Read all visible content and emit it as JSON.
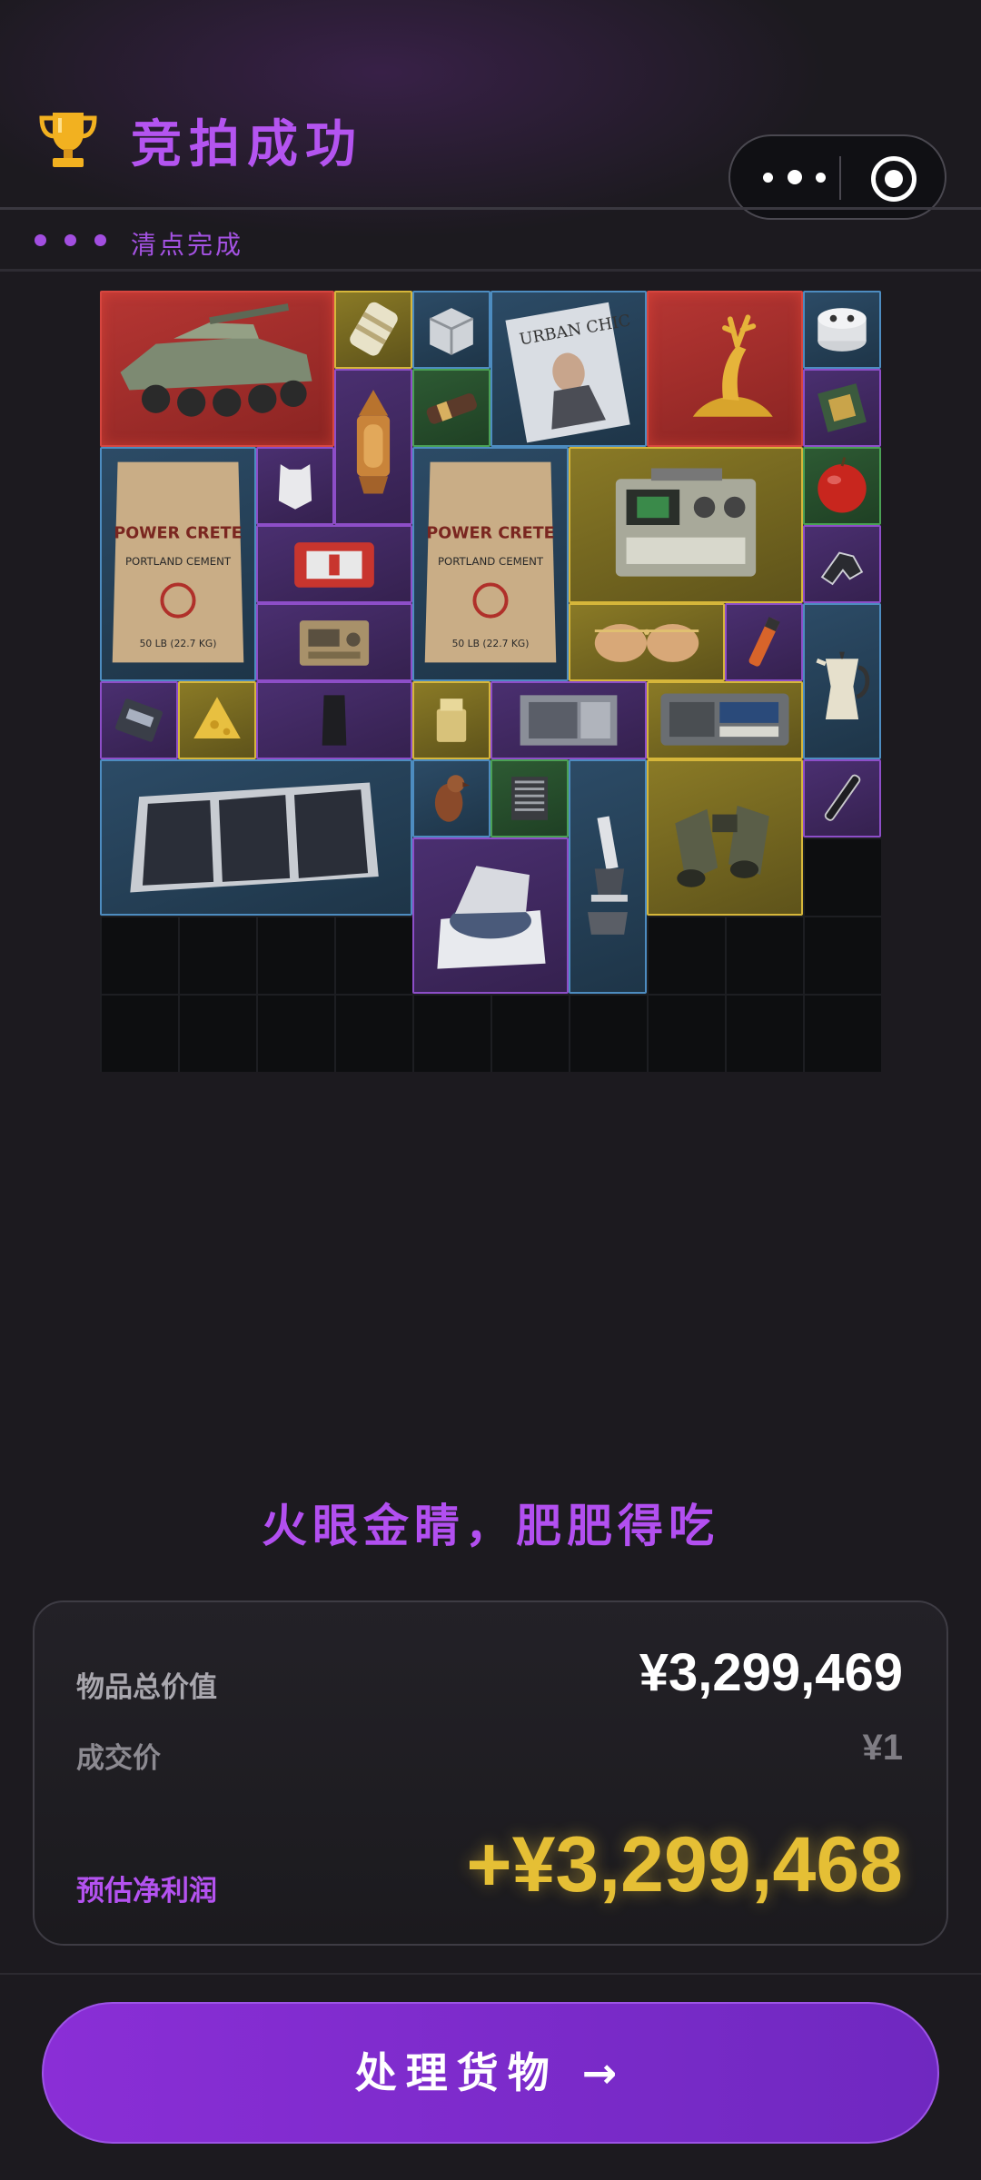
{
  "header": {
    "title": "竞拍成功",
    "trophy_icon": "trophy-icon",
    "status_text": "清点完成",
    "capsule": {
      "more_icon": "more-dots-icon",
      "close_icon": "target-close-icon"
    }
  },
  "inventory": {
    "grid": "10x10",
    "items": [
      {
        "name": "armored-vehicle",
        "rarity": "red"
      },
      {
        "name": "antenna-cylinder",
        "rarity": "yellow"
      },
      {
        "name": "server-unit",
        "rarity": "blue"
      },
      {
        "name": "urban-chic-magazine",
        "rarity": "blue"
      },
      {
        "name": "golden-deer-figurine",
        "rarity": "red"
      },
      {
        "name": "electronic-module",
        "rarity": "blue"
      },
      {
        "name": "ornate-lantern",
        "rarity": "purple"
      },
      {
        "name": "battery-pack",
        "rarity": "green"
      },
      {
        "name": "circuit-chip",
        "rarity": "purple"
      },
      {
        "name": "cement-bag",
        "rarity": "blue"
      },
      {
        "name": "body-armor-plate",
        "rarity": "purple"
      },
      {
        "name": "cement-bag",
        "rarity": "blue"
      },
      {
        "name": "radio-transceiver",
        "rarity": "yellow"
      },
      {
        "name": "apple",
        "rarity": "green"
      },
      {
        "name": "first-aid-kit",
        "rarity": "purple"
      },
      {
        "name": "tactical-handle",
        "rarity": "purple"
      },
      {
        "name": "field-radio",
        "rarity": "purple"
      },
      {
        "name": "aviator-sunglasses",
        "rarity": "yellow"
      },
      {
        "name": "signal-flare",
        "rarity": "purple"
      },
      {
        "name": "moka-pot",
        "rarity": "blue"
      },
      {
        "name": "hard-drive",
        "rarity": "purple"
      },
      {
        "name": "cheese-wedge",
        "rarity": "yellow"
      },
      {
        "name": "ceramic-plate",
        "rarity": "purple"
      },
      {
        "name": "zippo-lighter",
        "rarity": "yellow"
      },
      {
        "name": "graphics-card",
        "rarity": "purple"
      },
      {
        "name": "control-panel",
        "rarity": "yellow"
      },
      {
        "name": "solar-panel",
        "rarity": "blue"
      },
      {
        "name": "bird-figurine",
        "rarity": "blue"
      },
      {
        "name": "cpu-cooler",
        "rarity": "green"
      },
      {
        "name": "microscope",
        "rarity": "blue"
      },
      {
        "name": "binoculars",
        "rarity": "yellow"
      },
      {
        "name": "fountain-pen",
        "rarity": "purple"
      },
      {
        "name": "centrifuge",
        "rarity": "purple"
      }
    ]
  },
  "summary": {
    "slogan": "火眼金睛，肥肥得吃",
    "total_label": "物品总价值",
    "total_value": "¥3,299,469",
    "deal_label": "成交价",
    "deal_value": "¥1",
    "profit_label": "预估净利润",
    "profit_value": "+¥3,299,468"
  },
  "action": {
    "label": "处理货物 →"
  },
  "colors": {
    "accent_purple": "#b454f0",
    "profit_gold": "#e5bf35",
    "rarity_red": "#d6453f",
    "rarity_yellow": "#d6b63a",
    "rarity_blue": "#4d8cc0",
    "rarity_purple": "#8d4ec8",
    "rarity_green": "#4aa054"
  }
}
